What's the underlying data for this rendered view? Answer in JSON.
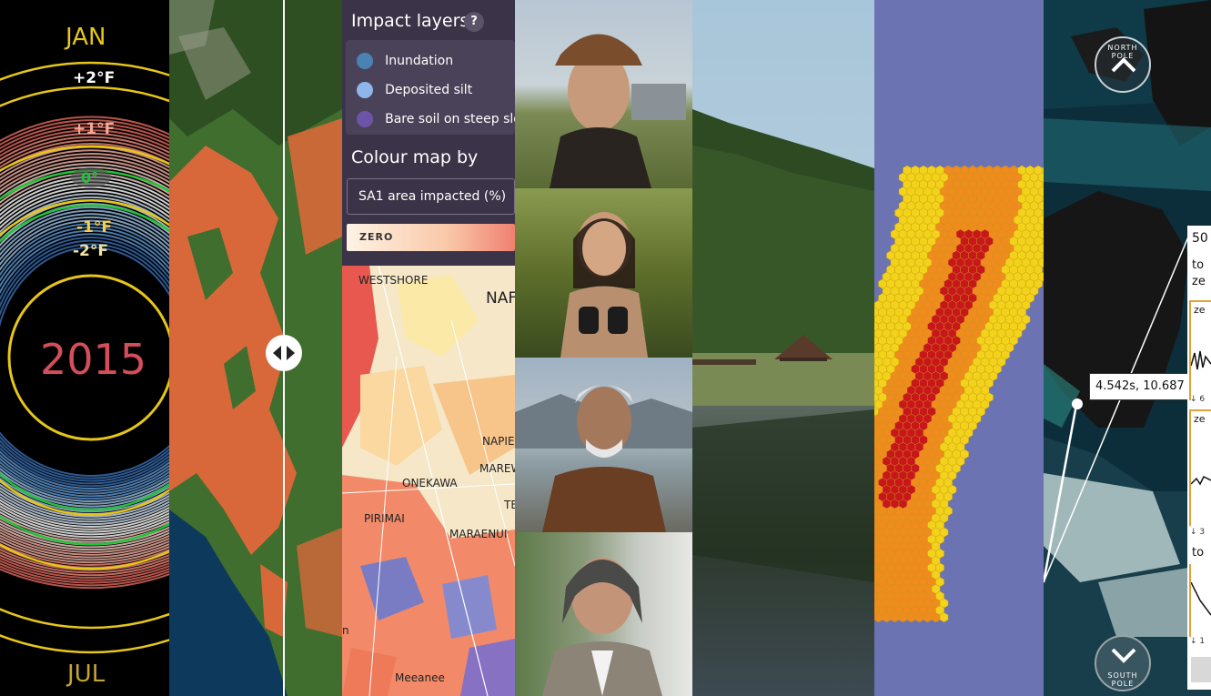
{
  "spiral": {
    "top_month": "JAN",
    "bottom_month": "JUL",
    "year": "2015",
    "ring_labels": [
      "+2°F",
      "+1°F",
      "0°",
      "-1°F",
      "-2°F"
    ],
    "colors": {
      "yellow": "#e6c619",
      "green": "#22c23a",
      "red": "#d44e5a"
    }
  },
  "satellite": {
    "slider_icon": "left-right-arrows-icon",
    "colors": {
      "flood": "#d8683a",
      "land": "#3f6e2e",
      "sea": "#0d3a5c"
    }
  },
  "impact": {
    "title": "Impact layers",
    "help": "?",
    "layers": [
      {
        "label": "Inundation",
        "color": "#4b82b4"
      },
      {
        "label": "Deposited silt",
        "color": "#8fb6ea"
      },
      {
        "label": "Bare soil on steep slop",
        "color": "#6c55a8"
      }
    ],
    "colour_map_title": "Colour map by",
    "select_value": "SA1 area impacted (%)",
    "legend_zero": "ZERO",
    "places": [
      "WESTSHORE",
      "NAF",
      "NAPIE",
      "MAREW",
      "ONEKAWA",
      "TE",
      "PIRIMAI",
      "MARAENUI",
      "Meeanee",
      "n"
    ]
  },
  "portraits": {
    "count": 4
  },
  "hex": {
    "colors": {
      "bg": "#6b73b3",
      "yellow": "#f2d21b",
      "orange": "#f08b1e",
      "red": "#c8161b"
    }
  },
  "globe": {
    "north_label": "NORTH POLE",
    "south_label": "SOUTH POLE",
    "north_icon": "chevron-up-icon",
    "south_icon": "chevron-down-icon",
    "coord_readout": "4.542s, 10.687",
    "panel_texts": [
      "50",
      "to",
      "ze",
      "ze",
      "ze",
      "to"
    ],
    "panel_ticks": [
      "↓ 6",
      "↓ 3",
      "↓ 1"
    ]
  }
}
